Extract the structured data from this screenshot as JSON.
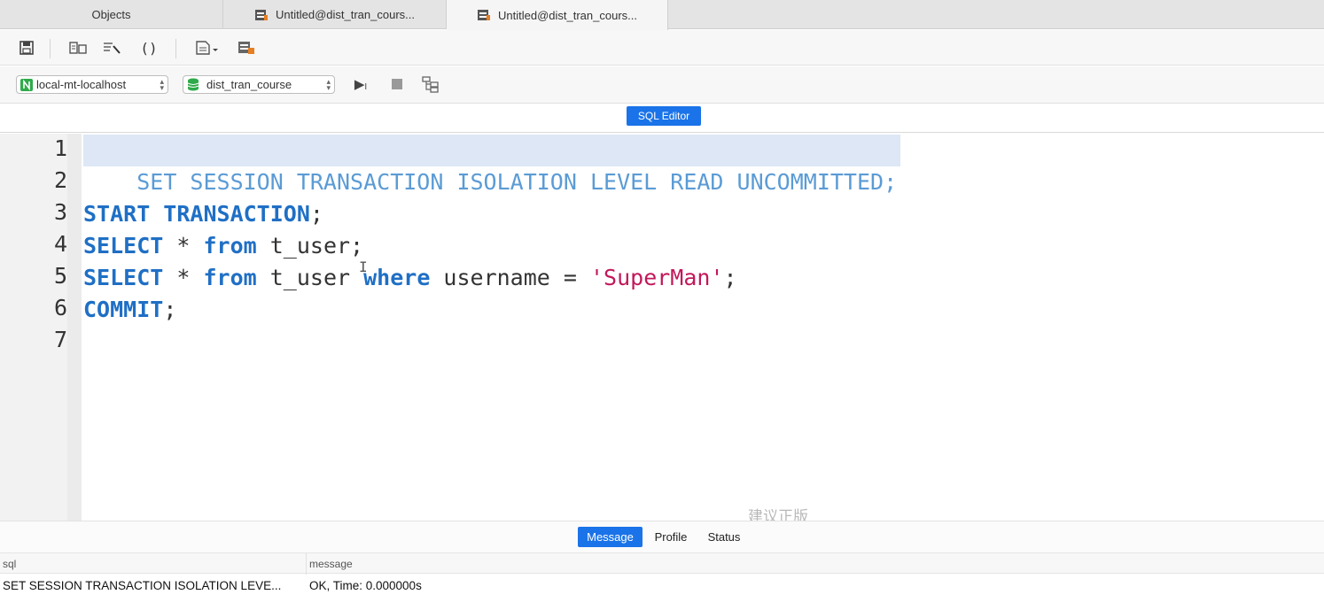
{
  "tabs": [
    {
      "label": "Objects"
    },
    {
      "label": "Untitled@dist_tran_cours..."
    },
    {
      "label": "Untitled@dist_tran_cours..."
    }
  ],
  "toolbar": {
    "icons": [
      "save-icon",
      "format-icon",
      "beautify-icon",
      "brackets-icon",
      "snippet-icon",
      "query-builder-icon"
    ],
    "brackets_glyph": "()"
  },
  "connection": {
    "server": "local-mt-localhost",
    "database": "dist_tran_course",
    "run_glyph": "▶",
    "run_suffix": "I"
  },
  "editor": {
    "header_button": "SQL Editor",
    "line_numbers": [
      "1",
      "2",
      "3",
      "4",
      "5",
      "6",
      "7"
    ],
    "line1": "SET SESSION TRANSACTION ISOLATION LEVEL READ UNCOMMITTED;",
    "line3_kw": "START TRANSACTION",
    "line3_end": ";",
    "line4_kw1": "SELECT",
    "line4_op": " * ",
    "line4_kw2": "from",
    "line4_rest": " t_user;",
    "line5_kw1": "SELECT",
    "line5_op": " * ",
    "line5_kw2": "from",
    "line5_mid": " t_user ",
    "line5_kw3": "where",
    "line5_col": " username = ",
    "line5_str": "'SuperMan'",
    "line5_end": ";",
    "line6_kw": "COMMIT",
    "line6_end": ";",
    "watermark": "建议正版",
    "text_cursor": "I"
  },
  "results": {
    "tabs": [
      "Message",
      "Profile",
      "Status"
    ],
    "active_tab": "Message",
    "columns": [
      "sql",
      "message"
    ],
    "rows": [
      {
        "sql": "SET SESSION TRANSACTION ISOLATION LEVE...",
        "message": "OK, Time: 0.000000s"
      }
    ]
  },
  "colors": {
    "accent": "#1a73e8",
    "keyword": "#1f6fc5",
    "string": "#c2185b",
    "selection": "#dde7f5"
  }
}
